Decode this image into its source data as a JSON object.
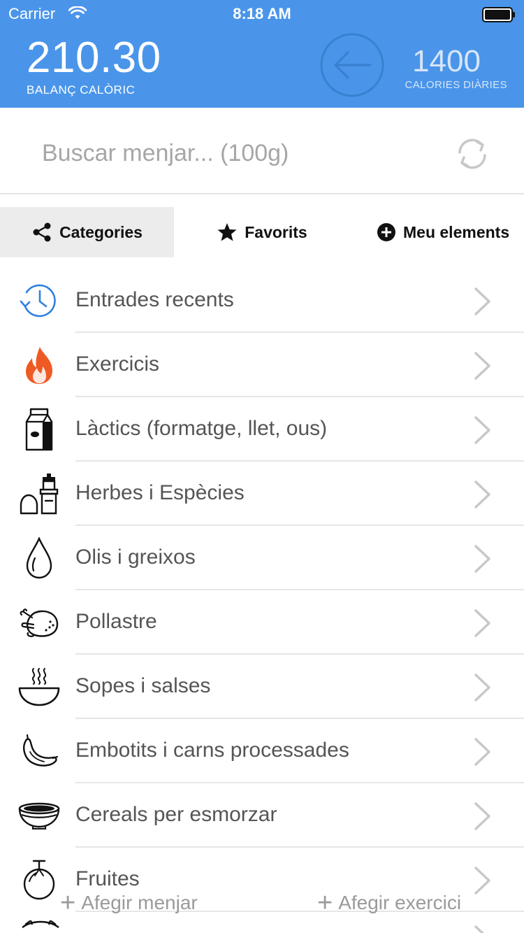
{
  "status_bar": {
    "carrier": "Carrier",
    "time": "8:18 AM"
  },
  "header": {
    "balance_value": "210.30",
    "balance_label": "BALANÇ CALÒRIC",
    "daily_value": "1400",
    "daily_label": "CALORIES DIÀRIES",
    "accent_color": "#4a95ea"
  },
  "search": {
    "placeholder": "Buscar menjar... (100g)",
    "value": ""
  },
  "tabs": [
    {
      "label": "Categories",
      "icon": "share-icon",
      "selected": true
    },
    {
      "label": "Favorits",
      "icon": "star-icon",
      "selected": false
    },
    {
      "label": "Meu elements",
      "icon": "plus-circle-icon",
      "selected": false
    }
  ],
  "categories": [
    {
      "label": "Entrades recents",
      "icon": "history-clock-icon"
    },
    {
      "label": "Exercicis",
      "icon": "flame-icon"
    },
    {
      "label": "Làctics (formatge, llet, ous)",
      "icon": "milk-carton-icon"
    },
    {
      "label": "Herbes i Espècies",
      "icon": "salt-pepper-icon"
    },
    {
      "label": "Olis i greixos",
      "icon": "oil-drop-icon"
    },
    {
      "label": "Pollastre",
      "icon": "roast-chicken-icon"
    },
    {
      "label": "Sopes i salses",
      "icon": "soup-bowl-icon"
    },
    {
      "label": "Embotits i carns processades",
      "icon": "sausage-icon"
    },
    {
      "label": "Cereals per esmorzar",
      "icon": "cereal-bowl-icon"
    },
    {
      "label": "Fruites",
      "icon": "fruit-icon"
    }
  ],
  "bottom_actions": {
    "add_food": "Afegir menjar",
    "add_exercise": "Afegir exercici"
  }
}
